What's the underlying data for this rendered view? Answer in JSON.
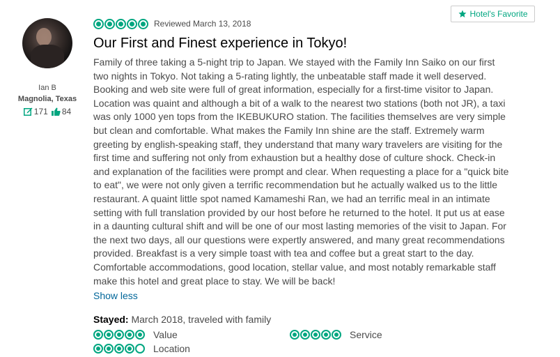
{
  "reviewer": {
    "name": "Ian B",
    "location": "Magnolia, Texas",
    "reviews_count": "171",
    "helpful_votes": "84"
  },
  "badge": {
    "label": "Hotel's Favorite",
    "icon": "star-icon"
  },
  "review": {
    "rating": 5,
    "date_text": "Reviewed March 13, 2018",
    "title": "Our First and Finest experience in Tokyo!",
    "body": "Family of three taking a 5-night trip to Japan. We stayed with the Family Inn Saiko on our first two nights in Tokyo. Not taking a 5-rating lightly, the unbeatable staff made it well deserved. Booking and web site were full of great information, especially for a first-time visitor to Japan. Location was quaint and although a bit of a walk to the nearest two stations (both not JR), a taxi was only 1000 yen tops from the IKEBUKURO station. The facilities themselves are very simple but clean and comfortable. What makes the Family Inn shine are the staff. Extremely warm greeting by english-speaking staff, they understand that many wary travelers are visiting for the first time and suffering not only from exhaustion but a healthy dose of culture shock. Check-in and explanation of the facilities were prompt and clear. When requesting a place for a \"quick bite to eat\", we were not only given a terrific recommendation but he actually walked us to the little restaurant. A quaint little spot named Kamameshi Ran, we had an terrific meal in an intimate setting with full translation provided by our host before he returned to the hotel. It put us at ease in a daunting cultural shift and will be one of our most lasting memories of the visit to Japan. For the next two days, all our questions were expertly answered, and many great recommendations provided. Breakfast is a very simple toast with tea and coffee but a great start to the day. Comfortable accommodations, good location, stellar value, and most notably remarkable staff make this hotel and great place to stay. We will be back!",
    "show_less": "Show less",
    "stayed_label": "Stayed:",
    "stayed_value": "March 2018, traveled with family"
  },
  "sub_ratings": [
    {
      "label": "Value",
      "rating": 5
    },
    {
      "label": "Service",
      "rating": 5
    },
    {
      "label": "Location",
      "rating": 4
    }
  ],
  "colors": {
    "accent": "#00a680",
    "link": "#006699"
  }
}
